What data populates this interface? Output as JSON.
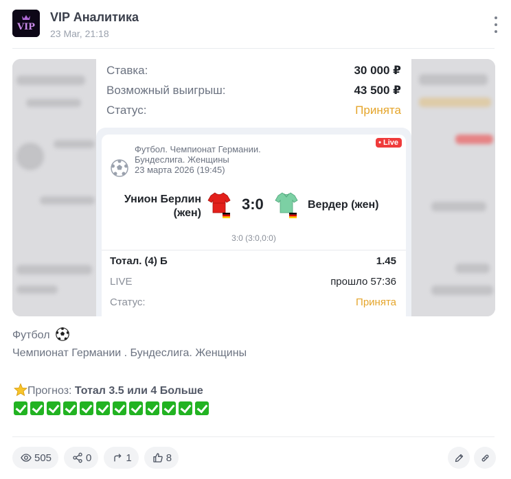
{
  "post": {
    "author": "VIP Аналитика",
    "date": "23 Mar, 21:18",
    "avatar_text": "VIP"
  },
  "screenshot": {
    "stake_label": "Ставка:",
    "stake_value": "30 000 ₽",
    "win_label": "Возможный выигрыш:",
    "win_value": "43 500 ₽",
    "status_label": "Статус:",
    "status_value": "Принята",
    "match": {
      "league_line1": "Футбол. Чемпионат Германии.",
      "league_line2": "Бундеслига. Женщины",
      "datetime": "23 марта 2026 (19:45)",
      "live_badge": "• Live",
      "home_team_line1": "Унион Берлин",
      "home_team_line2": "(жен)",
      "away_team": "Вердер (жен)",
      "score": "3:0",
      "subscore": "3:0 (3:0,0:0)"
    },
    "bet_name": "Тотал. (4) Б",
    "bet_odds": "1.45",
    "live_label": "LIVE",
    "elapsed": "прошло 57:36",
    "bet_status_label": "Статус:",
    "bet_status_value": "Принята",
    "colors": {
      "accepted": "#e5a52b",
      "live": "#ef3b3b"
    }
  },
  "body": {
    "sport": "Футбол",
    "sport_icon": "soccer-ball-icon",
    "league": "Чемпионат Германии . Бундеслига. Женщины",
    "forecast_label": "Прогноз:",
    "forecast_value": "Тотал 3.5 или 4 Больше",
    "forecast_icon": "star-icon",
    "check_count": 12
  },
  "stats": {
    "views": "505",
    "shares": "0",
    "reposts": "1",
    "likes": "8"
  }
}
